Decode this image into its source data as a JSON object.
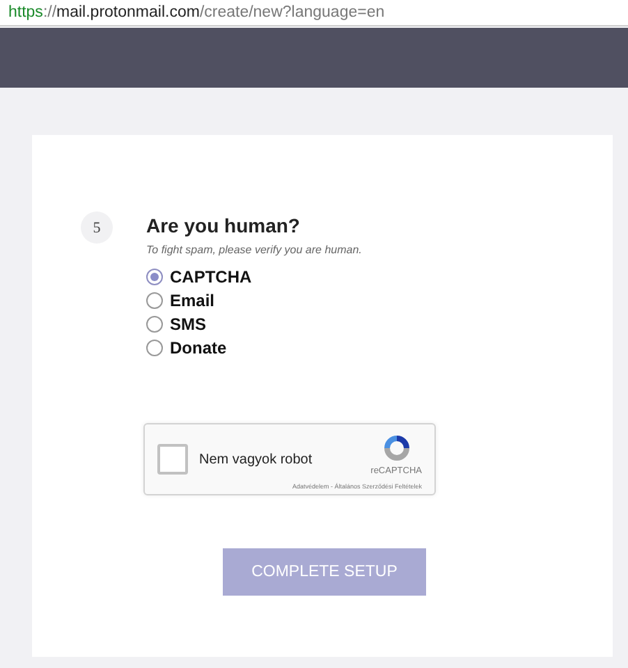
{
  "address_bar": {
    "url_parts": [
      {
        "kind": "scheme",
        "text": "https"
      },
      {
        "kind": "plain",
        "text": "://"
      },
      {
        "kind": "host",
        "text": "mail.protonmail.com"
      },
      {
        "kind": "plain",
        "text": "/create/new?language=en"
      }
    ]
  },
  "step": {
    "number": "5",
    "title": "Are you human?",
    "subtitle": "To fight spam, please verify you are human."
  },
  "options": [
    {
      "label": "CAPTCHA",
      "selected": true
    },
    {
      "label": "Email",
      "selected": false
    },
    {
      "label": "SMS",
      "selected": false
    },
    {
      "label": "Donate",
      "selected": false
    }
  ],
  "captcha": {
    "checkbox_label": "Nem vagyok robot",
    "checked": false,
    "brand": "reCAPTCHA",
    "footer": "Adatvédelem - Általános Szerződési Feltételek"
  },
  "button": {
    "label": "COMPLETE SETUP",
    "disabled": true
  }
}
